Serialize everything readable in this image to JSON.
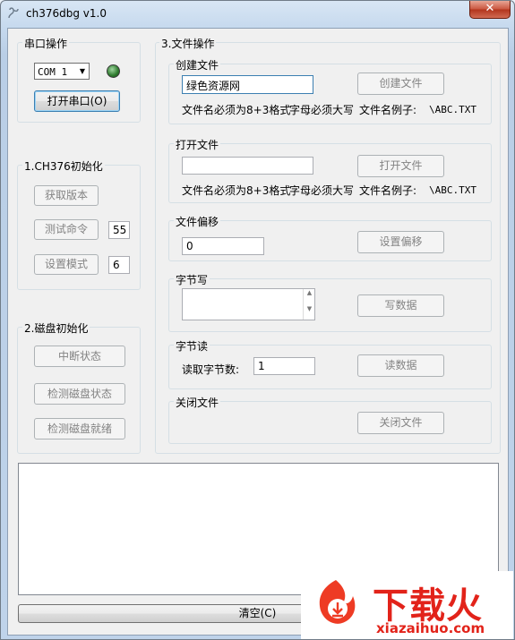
{
  "window": {
    "title": "ch376dbg v1.0",
    "close_glyph": "✕"
  },
  "serial": {
    "group_title": "串口操作",
    "port_value": "COM 1",
    "open_label": "打开串口(O)",
    "led_color": "#2d7a2d"
  },
  "init": {
    "group_title": "1.CH376初始化",
    "get_version_label": "获取版本",
    "test_cmd_label": "测试命令",
    "test_cmd_value": "55",
    "set_mode_label": "设置模式",
    "set_mode_value": "6"
  },
  "disk": {
    "group_title": "2.磁盘初始化",
    "interrupt_label": "中断状态",
    "check_status_label": "检测磁盘状态",
    "check_ready_label": "检测磁盘就绪"
  },
  "file_ops": {
    "group_title": "3.文件操作",
    "create": {
      "title": "创建文件",
      "input_value": "绿色资源网",
      "button_label": "创建文件",
      "hint_format": "文件名必须为8+3格式",
      "hint_upper": "字母必须大写",
      "hint_example_label": "文件名例子:",
      "hint_example": "\\ABC.TXT"
    },
    "open": {
      "title": "打开文件",
      "input_value": "",
      "button_label": "打开文件",
      "hint_format": "文件名必须为8+3格式",
      "hint_upper": "字母必须大写",
      "hint_example_label": "文件名例子:",
      "hint_example": "\\ABC.TXT"
    },
    "offset": {
      "title": "文件偏移",
      "input_value": "0",
      "button_label": "设置偏移"
    },
    "byte_write": {
      "title": "字节写",
      "input_value": "",
      "button_label": "写数据"
    },
    "byte_read": {
      "title": "字节读",
      "count_label": "读取字节数:",
      "count_value": "1",
      "button_label": "读数据"
    },
    "close": {
      "title": "关闭文件",
      "button_label": "关闭文件"
    }
  },
  "log": {
    "content": ""
  },
  "footer": {
    "clear_label": "清空(C)"
  },
  "watermark": {
    "title": "下载火",
    "url": "xiazaihuo.com",
    "color": "#e2231a"
  }
}
